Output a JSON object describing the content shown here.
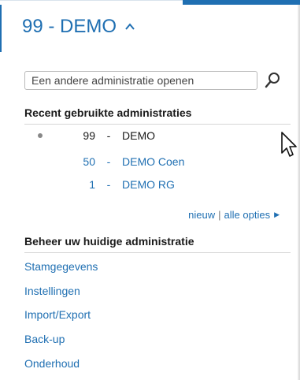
{
  "header": {
    "title": "99 - DEMO",
    "toggle_icon": "chevron-up-icon"
  },
  "search": {
    "placeholder": "Een andere administratie openen",
    "value": "",
    "icon": "search-icon"
  },
  "recent": {
    "title": "Recent gebruikte administraties",
    "items": [
      {
        "number": "99",
        "separator": "-",
        "name": "DEMO",
        "current": true
      },
      {
        "number": "50",
        "separator": "-",
        "name": "DEMO Coen",
        "current": false
      },
      {
        "number": "1",
        "separator": "-",
        "name": "DEMO RG",
        "current": false
      }
    ],
    "options": {
      "new_label": "nieuw",
      "separator": "|",
      "all_options_label": "alle opties"
    }
  },
  "manage": {
    "title": "Beheer uw huidige administratie",
    "links": [
      "Stamgegevens",
      "Instellingen",
      "Import/Export",
      "Back-up",
      "Onderhoud"
    ]
  },
  "colors": {
    "accent": "#1f6fb2",
    "text": "#1a1a1a",
    "divider": "#d6d6d6"
  }
}
